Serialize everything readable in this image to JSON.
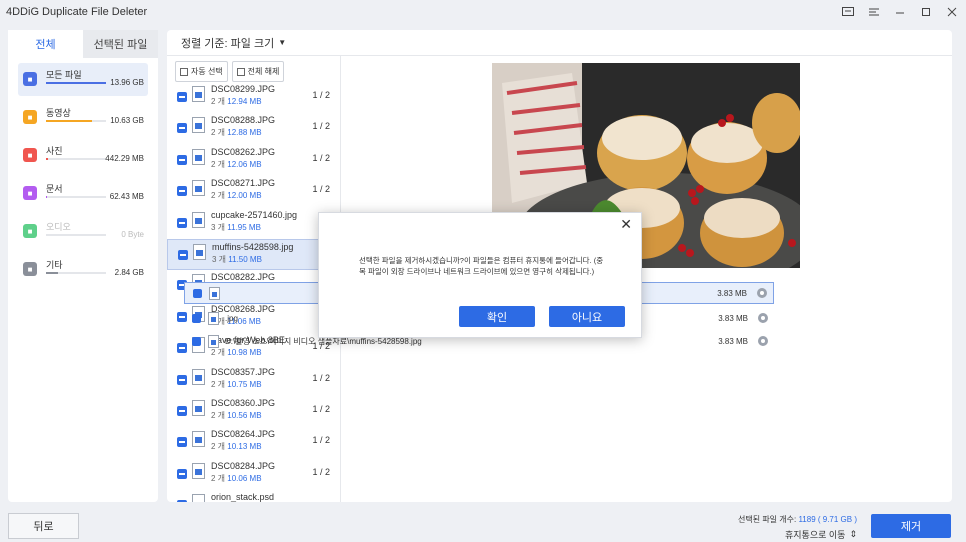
{
  "app": {
    "title": "4DDiG Duplicate File Deleter"
  },
  "window_icons": [
    "feedback-icon",
    "menu-icon",
    "minimize-icon",
    "maximize-icon",
    "close-icon"
  ],
  "sidebar": {
    "tabs": [
      {
        "label": "전체",
        "active": true
      },
      {
        "label": "선택된 파일",
        "active": false
      }
    ],
    "categories": [
      {
        "label": "모든 파일",
        "size": "13.96 GB",
        "icon": "folder-icon",
        "color": "#4a6fe3",
        "fill": 1.0,
        "selected": true,
        "disabled": false
      },
      {
        "label": "동영상",
        "size": "10.63 GB",
        "icon": "video-icon",
        "color": "#f5a623",
        "fill": 0.76,
        "selected": false,
        "disabled": false
      },
      {
        "label": "사진",
        "size": "442.29 MB",
        "icon": "photo-icon",
        "color": "#f0564f",
        "fill": 0.04,
        "selected": false,
        "disabled": false
      },
      {
        "label": "문서",
        "size": "62.43 MB",
        "icon": "document-icon",
        "color": "#b35cf0",
        "fill": 0.01,
        "selected": false,
        "disabled": false
      },
      {
        "label": "오디오",
        "size": "0 Byte",
        "icon": "audio-icon",
        "color": "#5ed08a",
        "fill": 0.0,
        "selected": false,
        "disabled": true
      },
      {
        "label": "기타",
        "size": "2.84 GB",
        "icon": "other-icon",
        "color": "#8a8f99",
        "fill": 0.2,
        "selected": false,
        "disabled": false
      }
    ]
  },
  "main": {
    "sort_label": "정렬 기준: 파일 크기",
    "auto_select": "자동 선택",
    "deselect_all": "전체 해제",
    "files": [
      {
        "name": "DSC08299.JPG",
        "count": "2 개",
        "size": "12.94 MB",
        "ratio": "1 / 2",
        "type": "img"
      },
      {
        "name": "DSC08288.JPG",
        "count": "2 개",
        "size": "12.88 MB",
        "ratio": "1 / 2",
        "type": "img"
      },
      {
        "name": "DSC08262.JPG",
        "count": "2 개",
        "size": "12.06 MB",
        "ratio": "1 / 2",
        "type": "img"
      },
      {
        "name": "DSC08271.JPG",
        "count": "2 개",
        "size": "12.00 MB",
        "ratio": "1 / 2",
        "type": "img"
      },
      {
        "name": "cupcake-2571460.jpg",
        "count": "3 개",
        "size": "11.95 MB",
        "ratio": "",
        "type": "img"
      },
      {
        "name": "muffins-5428598.jpg",
        "count": "3 개",
        "size": "11.50 MB",
        "ratio": "2",
        "type": "img",
        "selected": true
      },
      {
        "name": "DSC08282.JPG",
        "count": "2 개",
        "size": "11.44 MB",
        "ratio": "1",
        "type": "img"
      },
      {
        "name": "DSC08268.JPG",
        "count": "2 개",
        "size": "11.06 MB",
        "ratio": "1",
        "type": "img"
      },
      {
        "name": "Save for Web.8BE",
        "count": "2 개",
        "size": "10.98 MB",
        "ratio": "1 / 2",
        "type": "doc"
      },
      {
        "name": "DSC08357.JPG",
        "count": "2 개",
        "size": "10.75 MB",
        "ratio": "1 / 2",
        "type": "img"
      },
      {
        "name": "DSC08360.JPG",
        "count": "2 개",
        "size": "10.56 MB",
        "ratio": "1 / 2",
        "type": "img"
      },
      {
        "name": "DSC08264.JPG",
        "count": "2 개",
        "size": "10.13 MB",
        "ratio": "1 / 2",
        "type": "img"
      },
      {
        "name": "DSC08284.JPG",
        "count": "2 개",
        "size": "10.06 MB",
        "ratio": "1 / 2",
        "type": "img"
      },
      {
        "name": "orion_stack.psd",
        "count": "",
        "size": "",
        "ratio": "",
        "type": "doc"
      }
    ],
    "duplicates": [
      {
        "path": "",
        "size": "3.83 MB",
        "selected": true
      },
      {
        "path": ".jpg",
        "size": "3.83 MB",
        "selected": false
      },
      {
        "path": "D:\\촬영 소스\\이미지 비디오 샘플자료\\muffins-5428598.jpg",
        "size": "3.83 MB",
        "selected": false
      }
    ]
  },
  "dialog": {
    "message": "선택한 파일을 제거하시겠습니까?이 파일들은 컴퓨터 휴지통에 들어갑니다. (중복 파일이 외장 드라이브나 네트워크 드라이브에 있으면 영구히 삭제됩니다.)",
    "confirm": "확인",
    "cancel": "아니요"
  },
  "footer": {
    "back": "뒤로",
    "selected_label": "선택된 파일 개수:",
    "selected_count": "1189",
    "selected_size": "( 9.71 GB )",
    "recycle": "휴지통으로 이동",
    "remove": "제거"
  }
}
